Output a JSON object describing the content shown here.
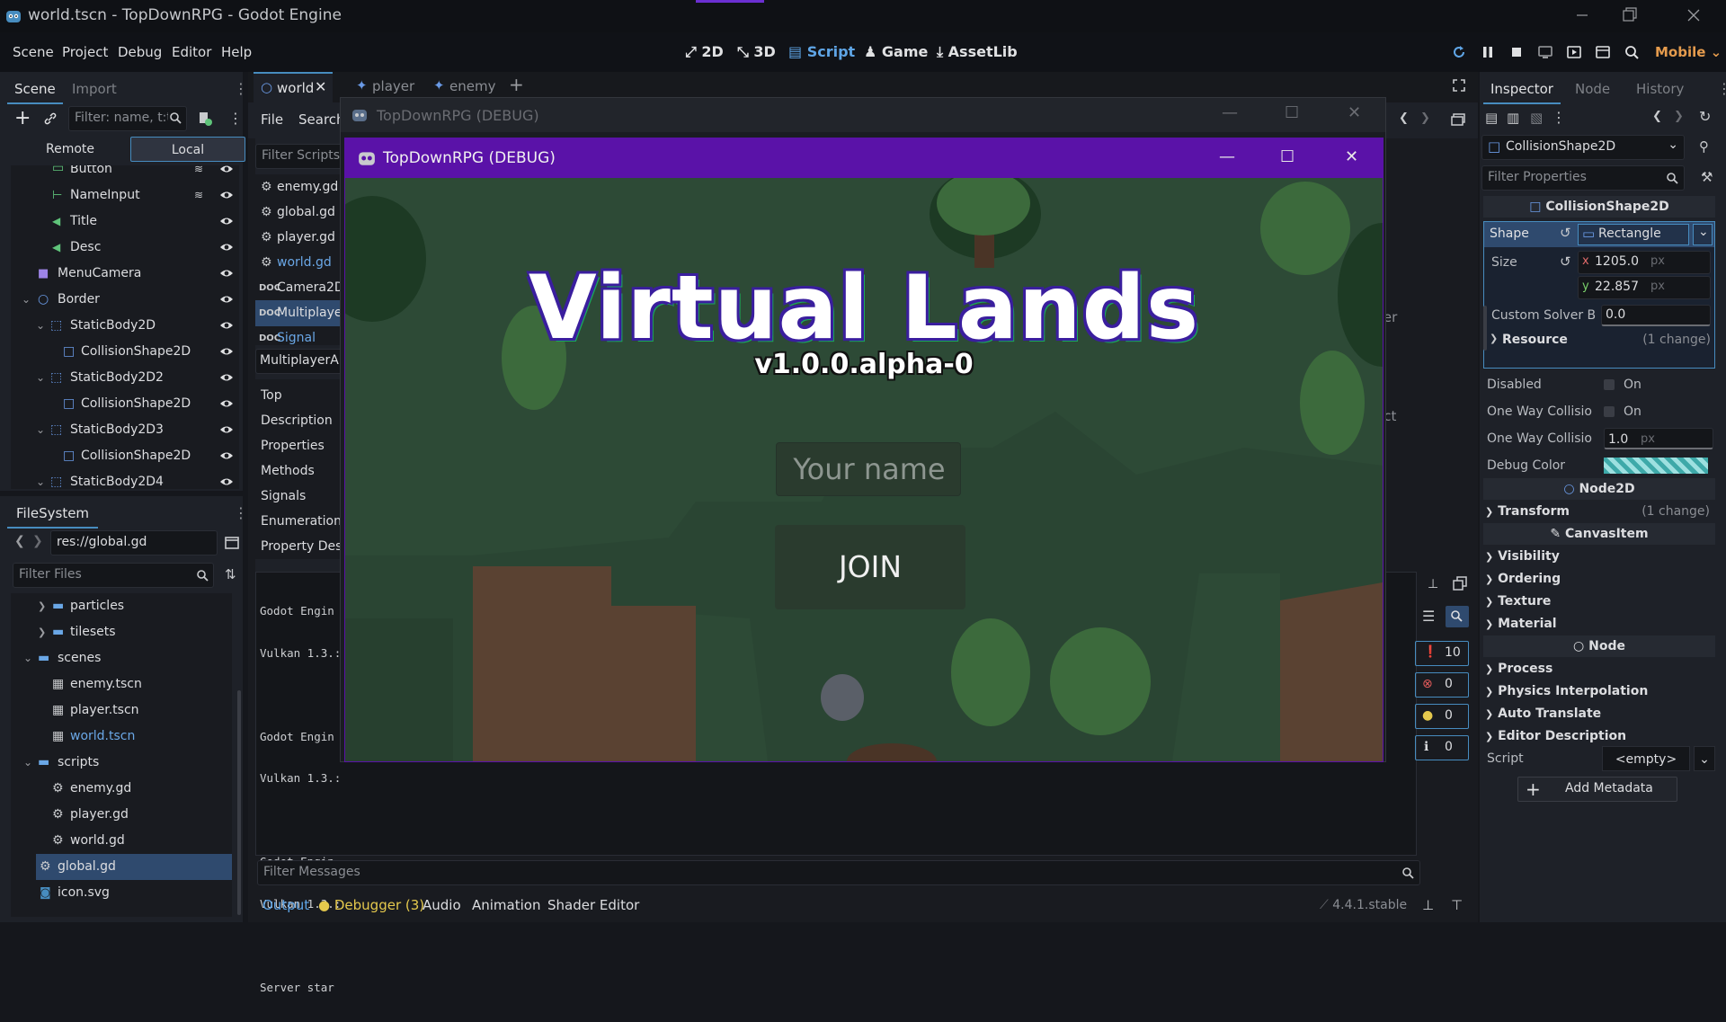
{
  "window": {
    "title": "world.tscn - TopDownRPG - Godot Engine"
  },
  "menus": [
    "Scene",
    "Project",
    "Debug",
    "Editor",
    "Help"
  ],
  "workspaces": {
    "2d": "2D",
    "3d": "3D",
    "script": "Script",
    "game": "Game",
    "assetlib": "AssetLib"
  },
  "renderer": "Mobile",
  "scene_dock": {
    "tabs": [
      "Scene",
      "Import"
    ],
    "filter_placeholder": "Filter: name, t:t",
    "remote": "Remote",
    "local": "Local",
    "nodes": [
      {
        "label": "Button",
        "icon": "button-icon"
      },
      {
        "label": "NameInput",
        "icon": "lineedit-icon"
      },
      {
        "label": "Title",
        "icon": "label-icon"
      },
      {
        "label": "Desc",
        "icon": "label-icon"
      },
      {
        "label": "MenuCamera",
        "icon": "camera2d-icon"
      },
      {
        "label": "Border",
        "icon": "node2d-icon"
      },
      {
        "label": "StaticBody2D",
        "icon": "staticbody2d-icon"
      },
      {
        "label": "CollisionShape2D",
        "icon": "collisionshape2d-icon"
      },
      {
        "label": "StaticBody2D2",
        "icon": "staticbody2d-icon"
      },
      {
        "label": "CollisionShape2D",
        "icon": "collisionshape2d-icon"
      },
      {
        "label": "StaticBody2D3",
        "icon": "staticbody2d-icon"
      },
      {
        "label": "CollisionShape2D",
        "icon": "collisionshape2d-icon"
      },
      {
        "label": "StaticBody2D4",
        "icon": "staticbody2d-icon"
      }
    ]
  },
  "filesystem": {
    "title": "FileSystem",
    "path": "res://global.gd",
    "filter_placeholder": "Filter Files",
    "items": [
      {
        "label": "particles",
        "type": "folder"
      },
      {
        "label": "tilesets",
        "type": "folder"
      },
      {
        "label": "scenes",
        "type": "folder"
      },
      {
        "label": "enemy.tscn",
        "type": "scene"
      },
      {
        "label": "player.tscn",
        "type": "scene"
      },
      {
        "label": "world.tscn",
        "type": "scene"
      },
      {
        "label": "scripts",
        "type": "folder"
      },
      {
        "label": "enemy.gd",
        "type": "script"
      },
      {
        "label": "player.gd",
        "type": "script"
      },
      {
        "label": "world.gd",
        "type": "script"
      },
      {
        "label": "global.gd",
        "type": "script"
      },
      {
        "label": "icon.svg",
        "type": "image"
      }
    ]
  },
  "editor_tabs": [
    "world",
    "player",
    "enemy"
  ],
  "script_editor": {
    "menus": [
      "File",
      "Search"
    ],
    "filter_scripts": "Filter Scripts",
    "scripts": [
      "enemy.gd",
      "global.gd",
      "player.gd",
      "world.gd",
      "Camera2D",
      "Multiplaye",
      "Signal"
    ],
    "class_name": "MultiplayerAPI",
    "members": [
      "Top",
      "Description",
      "Properties",
      "Methods",
      "Signals",
      "Enumeration",
      "Property Des"
    ]
  },
  "side_texts": {
    "a": "yer",
    "b": "ect"
  },
  "output": {
    "lines": [
      "Godot Engin",
      "Vulkan 1.3.:",
      "",
      "Godot Engin",
      "Vulkan 1.3.:",
      "",
      "Godot Engin",
      "Vulkan 1.3.:",
      "",
      "Server star"
    ],
    "filter_placeholder": "Filter Messages",
    "counts": {
      "messages": "10",
      "errors": "0",
      "warnings": "0",
      "info": "0"
    }
  },
  "bottom_tabs": {
    "output": "Output",
    "debugger": "Debugger (3)",
    "audio": "Audio",
    "animation": "Animation",
    "shader": "Shader Editor"
  },
  "version": "4.4.1.stable",
  "inspector": {
    "tabs": [
      "Inspector",
      "Node",
      "History"
    ],
    "node_type": "CollisionShape2D",
    "filter_placeholder": "Filter Properties",
    "header": "CollisionShape2D",
    "shape_label": "Shape",
    "shape_value": "Rectangle",
    "size_label": "Size",
    "size_x": "1205.0",
    "size_y": "22.857",
    "unit": "px",
    "x_label": "x",
    "y_label": "y",
    "solver_label": "Custom Solver B",
    "solver_value": "0.0",
    "resource_label": "Resource",
    "resource_change": "(1 change)",
    "disabled_label": "Disabled",
    "on": "On",
    "oneway_label": "One Way Collisio",
    "oneway2_label": "One Way Collisio",
    "oneway_margin": "1.0",
    "debug_color_label": "Debug Color",
    "node2d": "Node2D",
    "transform": "Transform",
    "transform_change": "(1 change)",
    "canvasitem": "CanvasItem",
    "visibility": "Visibility",
    "ordering": "Ordering",
    "texture": "Texture",
    "material": "Material",
    "node": "Node",
    "process": "Process",
    "physics_interp": "Physics Interpolation",
    "auto_translate": "Auto Translate",
    "editor_desc": "Editor Description",
    "script_label": "Script",
    "script_value": "<empty>",
    "add_metadata": "Add Metadata"
  },
  "debug_window_outer": {
    "title": "TopDownRPG (DEBUG)"
  },
  "debug_window": {
    "title": "TopDownRPG (DEBUG)",
    "game_title": "Virtual Lands",
    "game_version": "v1.0.0.alpha-0",
    "name_placeholder": "Your name",
    "join": "JOIN"
  },
  "colors": {
    "accent": "#478cbf",
    "debug_titlebar": "#5a12a8",
    "selected_bg": "#2f4a6e"
  }
}
